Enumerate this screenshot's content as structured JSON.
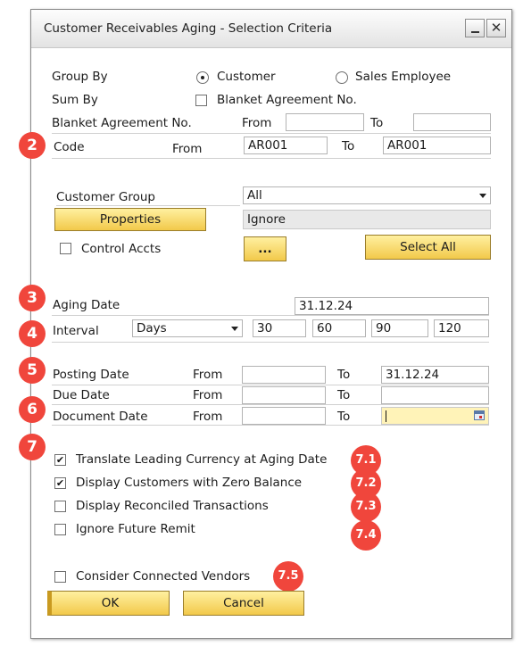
{
  "window": {
    "title": "Customer Receivables Aging - Selection Criteria",
    "close_glyph": "✕"
  },
  "group_by": {
    "label": "Group By",
    "opt_customer": "Customer",
    "opt_sales": "Sales Employee",
    "selected": "Customer"
  },
  "sum_by": {
    "label": "Sum By",
    "checkbox_label": "Blanket Agreement No.",
    "checked": false
  },
  "blanket": {
    "label": "Blanket Agreement No.",
    "from_label": "From",
    "to_label": "To",
    "from_value": "",
    "to_value": ""
  },
  "code": {
    "label": "Code",
    "from_label": "From",
    "to_label": "To",
    "from_value": "AR001",
    "to_value": "AR001"
  },
  "customer_group": {
    "label": "Customer Group",
    "value": "All"
  },
  "properties": {
    "button_label": "Properties",
    "value": "Ignore"
  },
  "control_accts": {
    "label": "Control Accts",
    "checked": false,
    "browse_label": "...",
    "select_all_label": "Select All"
  },
  "aging_date": {
    "label": "Aging Date",
    "value": "31.12.24"
  },
  "interval": {
    "label": "Interval",
    "unit": "Days",
    "v1": "30",
    "v2": "60",
    "v3": "90",
    "v4": "120"
  },
  "posting_date": {
    "label": "Posting Date",
    "from_label": "From",
    "to_label": "To",
    "from_value": "",
    "to_value": "31.12.24"
  },
  "due_date": {
    "label": "Due Date",
    "from_label": "From",
    "to_label": "To",
    "from_value": "",
    "to_value": ""
  },
  "document_date": {
    "label": "Document Date",
    "from_label": "From",
    "to_label": "To",
    "from_value": "",
    "to_value": ""
  },
  "options": [
    {
      "label": "Translate Leading Currency at Aging Date",
      "checked": true,
      "badge": "7.1"
    },
    {
      "label": "Display Customers with Zero Balance",
      "checked": true,
      "badge": "7.2"
    },
    {
      "label": "Display Reconciled Transactions",
      "checked": false,
      "badge": "7.3"
    },
    {
      "label": "Ignore Future Remit",
      "checked": false,
      "badge": "7.4"
    }
  ],
  "connected_vendors": {
    "label": "Consider Connected Vendors",
    "checked": false,
    "badge": "7.5"
  },
  "footer": {
    "ok_label": "OK",
    "cancel_label": "Cancel"
  },
  "badges": {
    "b2": "2",
    "b3": "3",
    "b4": "4",
    "b5": "5",
    "b6": "6",
    "b7": "7"
  },
  "colors": {
    "badge": "#f0463c",
    "button_yellow": "#f2c94a",
    "focus_yellow": "#fff3b8"
  },
  "check_glyph": "✔"
}
